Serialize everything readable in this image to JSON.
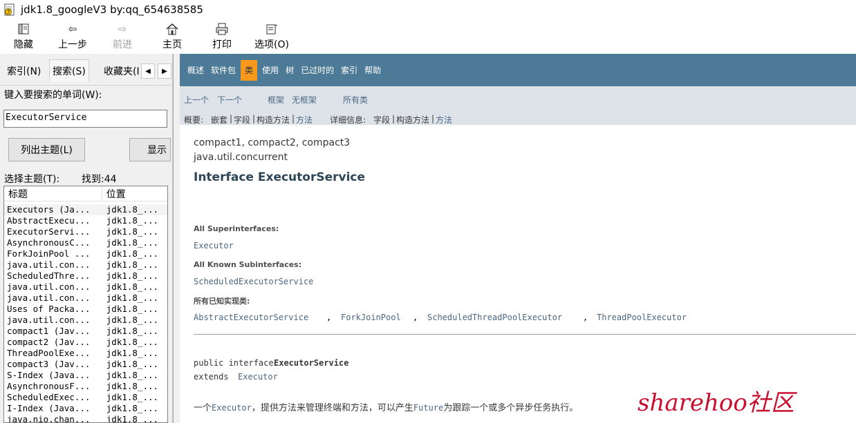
{
  "window": {
    "title": "jdk1.8_googleV3 by:qq_654638585"
  },
  "toolbar": {
    "buttons": [
      {
        "label": "隐藏",
        "icon": "hide-icon"
      },
      {
        "label": "上一步",
        "icon": "back-arrow-icon"
      },
      {
        "label": "前进",
        "icon": "forward-arrow-icon"
      },
      {
        "label": "主页",
        "icon": "home-icon"
      },
      {
        "label": "打印",
        "icon": "printer-icon"
      },
      {
        "label": "选项(O)",
        "icon": "options-icon"
      }
    ]
  },
  "left": {
    "tabs": {
      "index": "索引(N)",
      "search": "搜索(S)",
      "favorites": "收藏夹(I"
    },
    "search_prompt": "键入要搜索的单词(W):",
    "search_value": "ExecutorService",
    "list_topics_button": "列出主题(L)",
    "display_button": "显示",
    "select_topic_label": "选择主题(T):",
    "found_label": "找到:44",
    "columns": {
      "title": "标题",
      "location": "位置"
    },
    "rows": [
      {
        "title": "Executors (Ja...",
        "location": "jdk1.8_..."
      },
      {
        "title": "AbstractExecu...",
        "location": "jdk1.8_..."
      },
      {
        "title": "ExecutorServi...",
        "location": "jdk1.8_..."
      },
      {
        "title": "AsynchronousC...",
        "location": "jdk1.8_..."
      },
      {
        "title": "ForkJoinPool ...",
        "location": "jdk1.8_..."
      },
      {
        "title": "java.util.con...",
        "location": "jdk1.8_..."
      },
      {
        "title": "ScheduledThre...",
        "location": "jdk1.8_..."
      },
      {
        "title": "java.util.con...",
        "location": "jdk1.8_..."
      },
      {
        "title": "java.util.con...",
        "location": "jdk1.8_..."
      },
      {
        "title": "Uses of Packa...",
        "location": "jdk1.8_..."
      },
      {
        "title": "java.util.con...",
        "location": "jdk1.8_..."
      },
      {
        "title": "compact1 (Jav...",
        "location": "jdk1.8_..."
      },
      {
        "title": "compact2 (Jav...",
        "location": "jdk1.8_..."
      },
      {
        "title": "ThreadPoolExe...",
        "location": "jdk1.8_..."
      },
      {
        "title": "compact3 (Jav...",
        "location": "jdk1.8_..."
      },
      {
        "title": "S-Index (Java...",
        "location": "jdk1.8_..."
      },
      {
        "title": "AsynchronousF...",
        "location": "jdk1.8_..."
      },
      {
        "title": "ScheduledExec...",
        "location": "jdk1.8_..."
      },
      {
        "title": "I-Index (Java...",
        "location": "jdk1.8_..."
      },
      {
        "title": "java.nio.chan...",
        "location": "jdk1.8_..."
      }
    ]
  },
  "content": {
    "navbar": [
      "概述",
      "软件包",
      "类",
      "使用",
      "树",
      "已过时的",
      "索引",
      "帮助"
    ],
    "active_nav": "类",
    "subnav": {
      "prev": "上一个",
      "next": "下一个",
      "frames": "框架",
      "no_frames": "无框架",
      "all_classes": "所有类",
      "summary_label": "概要:",
      "summary_nested": "嵌套",
      "summary_field": "字段",
      "summary_constr": "构造方法",
      "summary_method": "方法",
      "detail_label": "详细信息:",
      "detail_field": "字段",
      "detail_constr": "构造方法",
      "detail_method": "方法",
      "sep": "|"
    },
    "profiles": "compact1, compact2, compact3",
    "package": "java.util.concurrent",
    "heading": "Interface ExecutorService",
    "superinterfaces_label": "All Superinterfaces:",
    "superinterfaces": "Executor",
    "subinterfaces_label": "All Known Subinterfaces:",
    "subinterfaces": "ScheduledExecutorService",
    "implementing_label": "所有已知实现类:",
    "implementing": [
      "AbstractExecutorService",
      "ForkJoinPool",
      "ScheduledThreadPoolExecutor",
      "ThreadPoolExecutor"
    ],
    "comma": ",",
    "decl_prefix": "public interface ",
    "decl_name": "ExecutorService",
    "extends_prefix": "extends ",
    "extends_name": "Executor",
    "desc_1": "一个",
    "desc_link1": "Executor",
    "desc_2": "，提供方法来管理终端和方法，可以产生",
    "desc_link2": "Future",
    "desc_3": "为跟踪一个或多个异步任务执行。"
  },
  "watermark": "sharehoo社区",
  "colors": {
    "navbar": "#4d7a97",
    "active_nav": "#f8981d",
    "subnav": "#dee3e9",
    "link": "#4a6782",
    "watermark": "#c8102e"
  }
}
